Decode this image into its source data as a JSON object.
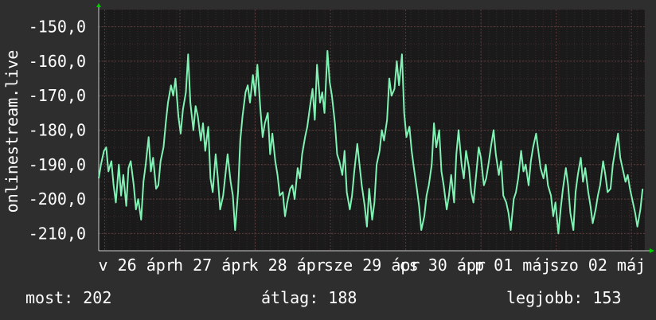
{
  "chart_data": {
    "type": "line",
    "ylabel": "onlinestream.live",
    "ylim": [
      -215,
      -145
    ],
    "yticks": [
      -150,
      -160,
      -170,
      -180,
      -190,
      -200,
      -210
    ],
    "ytick_labels": [
      "-150,0",
      "-160,0",
      "-170,0",
      "-180,0",
      "-190,0",
      "-200,0",
      "-210,0"
    ],
    "xlim": [
      0,
      7.33
    ],
    "xticks": [
      0.08,
      1.09,
      2.1,
      3.11,
      4.12,
      5.13,
      6.14,
      7.15
    ],
    "xtick_labels": [
      "v 26 ápr",
      "h 27 ápr",
      "k 28 ápr",
      "sze 29 ápr",
      "cs 30 ápr",
      "p 01 máj",
      "szo 02 máj",
      ""
    ],
    "grid": true,
    "colors": {
      "background": "#2e2e2e",
      "plot_background": "#1a1a1a",
      "line": "#7ff2b4",
      "grid": "#5a3a3a",
      "axis_arrow": "#00cc00"
    },
    "series": [
      {
        "x": [
          0,
          0.03,
          0.07,
          0.1,
          0.13,
          0.17,
          0.2,
          0.23,
          0.27,
          0.3,
          0.33,
          0.37,
          0.4,
          0.43,
          0.47,
          0.5,
          0.53,
          0.57,
          0.6,
          0.63,
          0.67,
          0.7,
          0.73,
          0.77,
          0.8,
          0.83,
          0.87,
          0.9,
          0.93,
          0.97,
          1,
          1.03,
          1.07,
          1.1,
          1.13,
          1.17,
          1.2,
          1.23,
          1.27,
          1.3,
          1.33,
          1.37,
          1.4,
          1.43,
          1.47,
          1.5,
          1.53,
          1.57,
          1.6,
          1.63,
          1.67,
          1.7,
          1.73,
          1.77,
          1.8,
          1.83,
          1.87,
          1.9,
          1.93,
          1.97,
          2,
          2.03,
          2.07,
          2.1,
          2.13,
          2.17,
          2.2,
          2.23,
          2.27,
          2.3,
          2.33,
          2.37,
          2.4,
          2.43,
          2.47,
          2.5,
          2.53,
          2.57,
          2.6,
          2.63,
          2.67,
          2.7,
          2.73,
          2.77,
          2.8,
          2.83,
          2.87,
          2.9,
          2.93,
          2.97,
          3,
          3.03,
          3.07,
          3.1,
          3.13,
          3.17,
          3.2,
          3.23,
          3.27,
          3.3,
          3.33,
          3.37,
          3.4,
          3.43,
          3.47,
          3.5,
          3.53,
          3.57,
          3.6,
          3.63,
          3.67,
          3.7,
          3.73,
          3.77,
          3.8,
          3.83,
          3.87,
          3.9,
          3.93,
          3.97,
          4,
          4.03,
          4.07,
          4.1,
          4.13,
          4.17,
          4.2,
          4.23,
          4.27,
          4.3,
          4.33,
          4.37,
          4.4,
          4.43,
          4.47,
          4.5,
          4.53,
          4.57,
          4.6,
          4.63,
          4.67,
          4.7,
          4.73,
          4.77,
          4.8,
          4.83,
          4.87,
          4.9,
          4.93,
          4.97,
          5,
          5.03,
          5.07,
          5.1,
          5.13,
          5.17,
          5.2,
          5.23,
          5.27,
          5.3,
          5.33,
          5.37,
          5.4,
          5.43,
          5.47,
          5.5,
          5.53,
          5.57,
          5.6,
          5.63,
          5.67,
          5.7,
          5.73,
          5.77,
          5.8,
          5.83,
          5.87,
          5.9,
          5.93,
          5.97,
          6,
          6.03,
          6.07,
          6.1,
          6.13,
          6.17,
          6.2,
          6.23,
          6.27,
          6.3,
          6.33,
          6.37,
          6.4,
          6.43,
          6.47,
          6.5,
          6.53,
          6.57,
          6.6,
          6.63,
          6.67,
          6.7,
          6.73,
          6.77,
          6.8,
          6.83,
          6.87,
          6.9,
          6.93,
          6.97,
          7,
          7.03,
          7.07,
          7.1,
          7.13,
          7.17,
          7.2,
          7.23,
          7.27,
          7.3
        ],
        "values": [
          -194,
          -190,
          -186,
          -185,
          -192,
          -189,
          -196,
          -201,
          -190,
          -199,
          -193,
          -202,
          -191,
          -189,
          -196,
          -203,
          -200,
          -206,
          -195,
          -190,
          -182,
          -192,
          -188,
          -197,
          -196,
          -189,
          -185,
          -178,
          -172,
          -167,
          -170,
          -165,
          -176,
          -181,
          -174,
          -169,
          -158,
          -172,
          -180,
          -173,
          -176,
          -183,
          -178,
          -186,
          -179,
          -194,
          -198,
          -187,
          -194,
          -203,
          -199,
          -193,
          -187,
          -195,
          -199,
          -209,
          -198,
          -183,
          -176,
          -169,
          -167,
          -172,
          -164,
          -170,
          -161,
          -174,
          -182,
          -178,
          -175,
          -187,
          -181,
          -189,
          -193,
          -199,
          -198,
          -205,
          -201,
          -197,
          -196,
          -200,
          -191,
          -194,
          -187,
          -182,
          -179,
          -174,
          -168,
          -177,
          -161,
          -172,
          -169,
          -175,
          -157,
          -166,
          -170,
          -178,
          -187,
          -189,
          -193,
          -186,
          -198,
          -203,
          -199,
          -192,
          -184,
          -190,
          -196,
          -202,
          -208,
          -197,
          -206,
          -201,
          -190,
          -186,
          -180,
          -183,
          -177,
          -165,
          -170,
          -168,
          -160,
          -167,
          -158,
          -175,
          -182,
          -179,
          -186,
          -191,
          -197,
          -202,
          -209,
          -205,
          -199,
          -196,
          -190,
          -178,
          -185,
          -180,
          -192,
          -196,
          -203,
          -199,
          -193,
          -201,
          -187,
          -180,
          -190,
          -194,
          -186,
          -191,
          -198,
          -201,
          -192,
          -185,
          -188,
          -196,
          -194,
          -190,
          -184,
          -180,
          -187,
          -193,
          -189,
          -199,
          -201,
          -204,
          -209,
          -200,
          -198,
          -194,
          -186,
          -192,
          -190,
          -196,
          -189,
          -185,
          -181,
          -186,
          -191,
          -194,
          -190,
          -196,
          -199,
          -205,
          -201,
          -210,
          -203,
          -197,
          -191,
          -196,
          -204,
          -209,
          -198,
          -193,
          -188,
          -195,
          -191,
          -198,
          -202,
          -207,
          -203,
          -199,
          -196,
          -189,
          -193,
          -198,
          -197,
          -190,
          -186,
          -181,
          -188,
          -191,
          -195,
          -193,
          -197,
          -201,
          -204,
          -208,
          -203,
          -197
        ],
        "line_width": 2
      }
    ]
  },
  "stats": {
    "current": "most: 202",
    "average": "átlag: 188",
    "best": "legjobb: 153"
  }
}
